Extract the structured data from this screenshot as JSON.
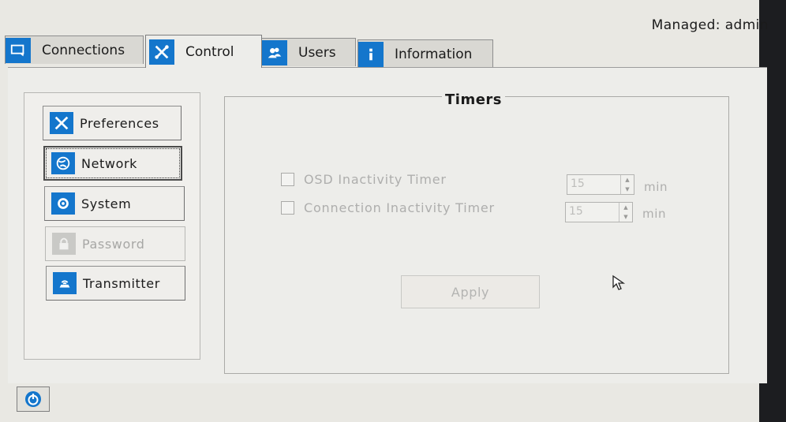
{
  "status": {
    "managed_label": "Managed:",
    "user": "admin"
  },
  "tabs": [
    {
      "label": "Connections",
      "icon": "monitor-icon",
      "active": false
    },
    {
      "label": "Control",
      "icon": "tools-icon",
      "active": true
    },
    {
      "label": "Users",
      "icon": "users-icon",
      "active": false
    },
    {
      "label": "Information",
      "icon": "info-icon",
      "active": false
    }
  ],
  "sidebar": {
    "items": [
      {
        "label": "Preferences",
        "icon": "tools-icon",
        "state": "normal"
      },
      {
        "label": "Network",
        "icon": "network-globe-icon",
        "state": "focused"
      },
      {
        "label": "System",
        "icon": "gear-icon",
        "state": "normal"
      },
      {
        "label": "Password",
        "icon": "lock-icon",
        "state": "disabled"
      },
      {
        "label": "Transmitter",
        "icon": "transmitter-icon",
        "state": "normal"
      }
    ]
  },
  "timers": {
    "title": "Timers",
    "osd": {
      "label": "OSD Inactivity Timer",
      "checked": false,
      "value": "15",
      "unit": "min"
    },
    "connection": {
      "label": "Connection Inactivity Timer",
      "checked": false,
      "value": "15",
      "unit": "min"
    },
    "apply_label": "Apply"
  },
  "colors": {
    "accent": "#1476cc",
    "background": "#e9e8e3",
    "disabled_text": "#aeaead"
  }
}
